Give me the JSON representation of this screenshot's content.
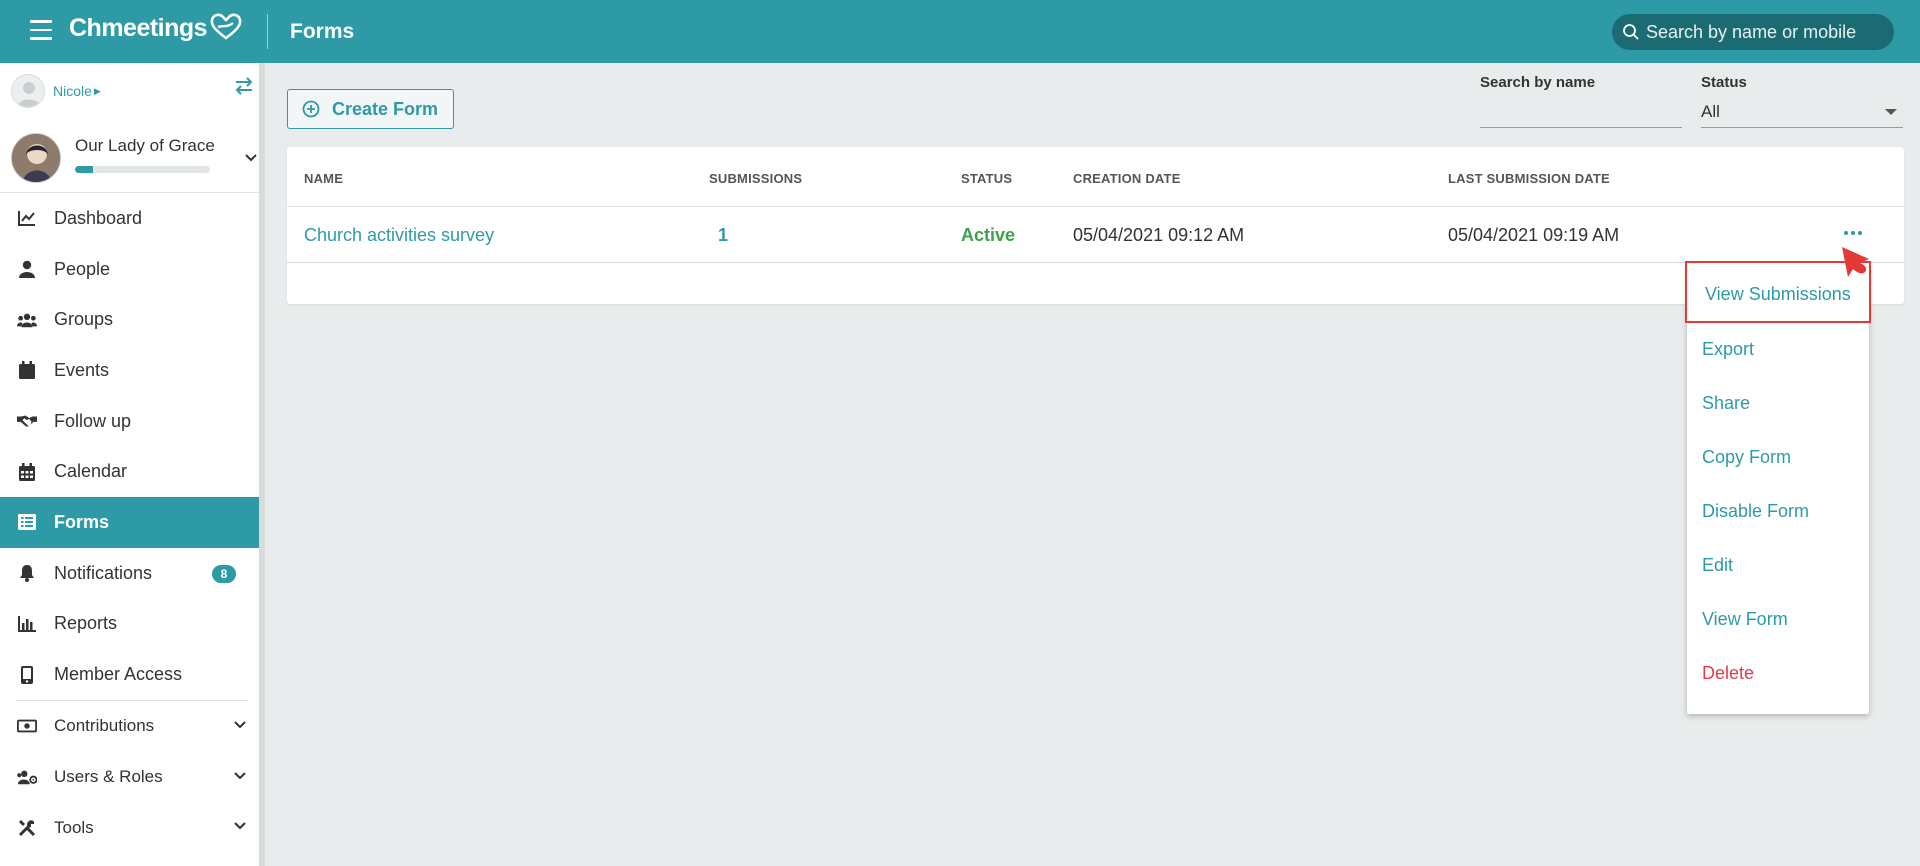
{
  "app": {
    "logo_text": "Chmeetings",
    "page_title": "Forms",
    "search_placeholder": "Search by name or mobile"
  },
  "sidebar": {
    "user_name": "Nicole",
    "org_name": "Our Lady of Grace",
    "org_progress": 0.13,
    "items": [
      {
        "label": "Dashboard",
        "icon": "chart-line-icon"
      },
      {
        "label": "People",
        "icon": "person-icon"
      },
      {
        "label": "Groups",
        "icon": "users-icon"
      },
      {
        "label": "Events",
        "icon": "calendar-icon"
      },
      {
        "label": "Follow up",
        "icon": "handshake-icon"
      },
      {
        "label": "Calendar",
        "icon": "calendar-grid-icon"
      },
      {
        "label": "Forms",
        "icon": "list-icon",
        "active": true
      },
      {
        "label": "Notifications",
        "icon": "bell-icon",
        "badge": "8"
      },
      {
        "label": "Reports",
        "icon": "bar-chart-icon"
      },
      {
        "label": "Member Access",
        "icon": "mobile-icon"
      },
      {
        "label": "Contributions",
        "icon": "money-icon",
        "expandable": true
      },
      {
        "label": "Users & Roles",
        "icon": "users-cog-icon",
        "expandable": true
      },
      {
        "label": "Tools",
        "icon": "tools-icon",
        "expandable": true
      }
    ]
  },
  "toolbar": {
    "create_label": "Create Form",
    "search_name_label": "Search by name",
    "search_name_value": "",
    "status_label": "Status",
    "status_value": "All"
  },
  "table": {
    "columns": [
      "NAME",
      "SUBMISSIONS",
      "STATUS",
      "CREATION DATE",
      "LAST SUBMISSION DATE"
    ],
    "rows": [
      {
        "name": "Church activities survey",
        "submissions": "1",
        "status": "Active",
        "creation_date": "05/04/2021 09:12 AM",
        "last_submission_date": "05/04/2021 09:19 AM"
      }
    ]
  },
  "menu": {
    "items": [
      "View Submissions",
      "Export",
      "Share",
      "Copy Form",
      "Disable Form",
      "Edit",
      "View Form",
      "Delete"
    ],
    "highlighted": "View Submissions"
  },
  "colors": {
    "primary": "#2e9aa6",
    "active_status": "#3ca24a",
    "danger": "#e5394b",
    "highlight_border": "#e53935"
  }
}
